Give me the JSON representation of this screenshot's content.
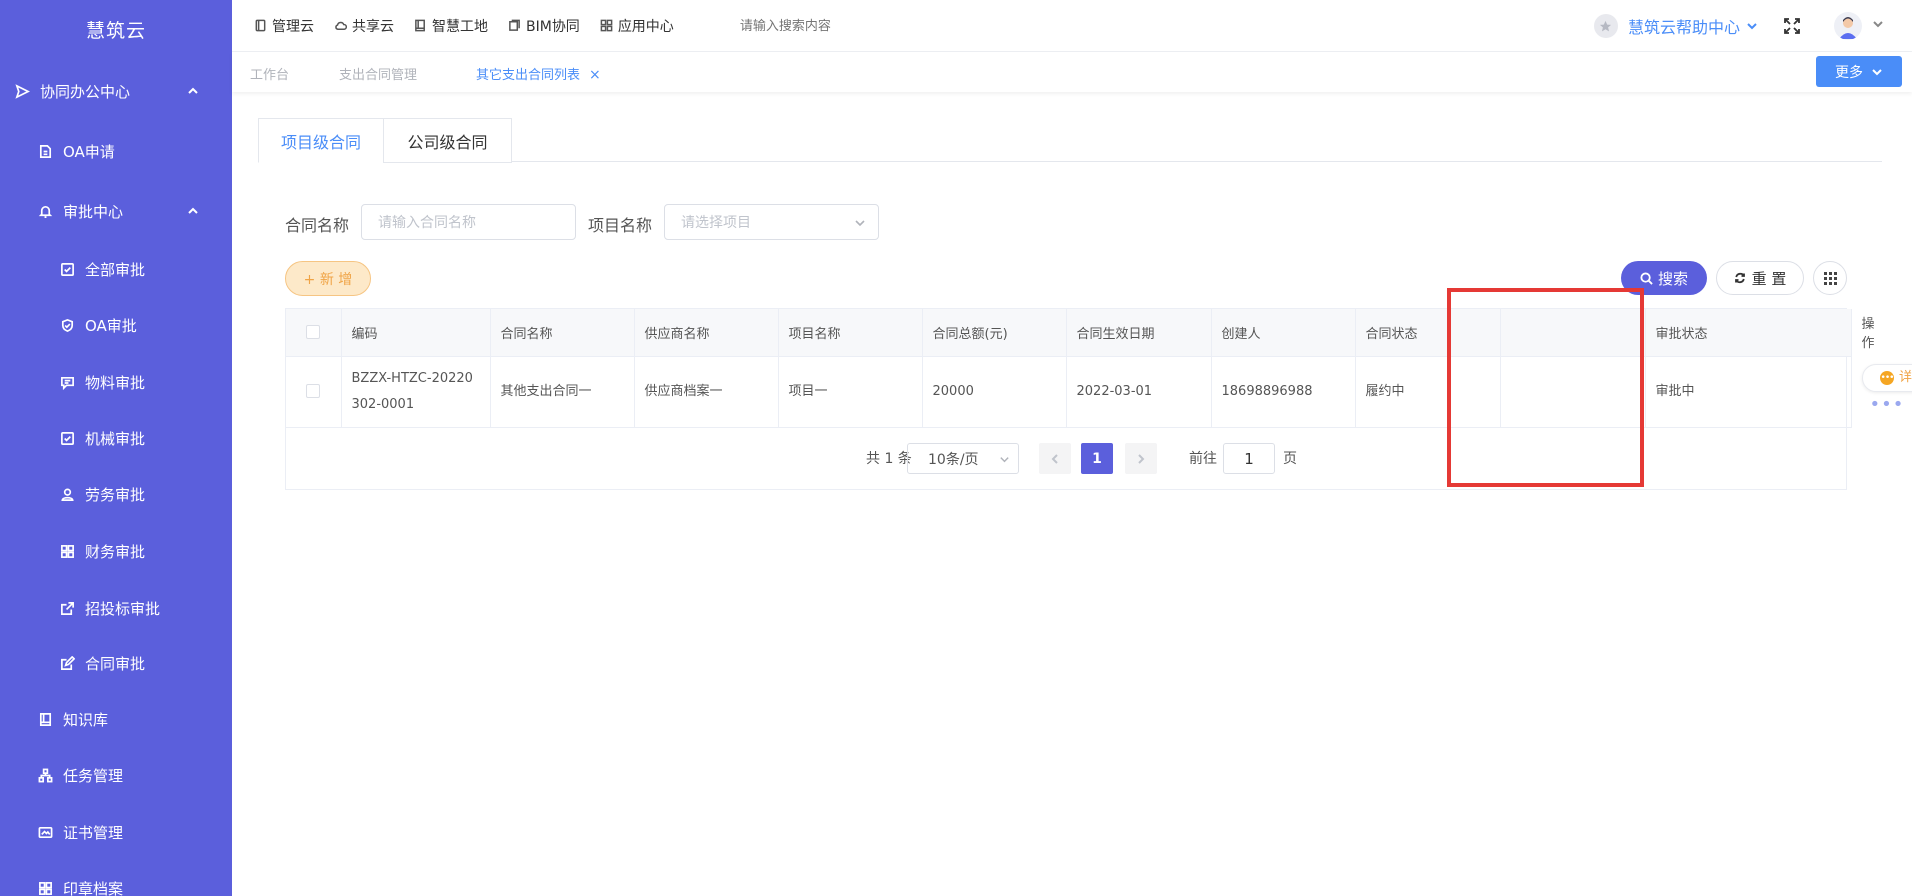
{
  "sidebar": {
    "logo": "慧筑云",
    "items": [
      {
        "label": "协同办公中心",
        "icon": "send-icon"
      },
      {
        "label": "OA申请",
        "icon": "document-icon"
      },
      {
        "label": "审批中心",
        "icon": "bell-icon"
      },
      {
        "label": "全部审批",
        "icon": "checkbox-icon"
      },
      {
        "label": "OA审批",
        "icon": "shield-check-icon"
      },
      {
        "label": "物料审批",
        "icon": "message-icon"
      },
      {
        "label": "机械审批",
        "icon": "checkbox-icon"
      },
      {
        "label": "劳务审批",
        "icon": "user-icon"
      },
      {
        "label": "财务审批",
        "icon": "grid-icon"
      },
      {
        "label": "招投标审批",
        "icon": "external-link-icon"
      },
      {
        "label": "合同审批",
        "icon": "edit-icon"
      },
      {
        "label": "知识库",
        "icon": "book-icon"
      },
      {
        "label": "任务管理",
        "icon": "sitemap-icon"
      },
      {
        "label": "证书管理",
        "icon": "id-card-icon"
      },
      {
        "label": "印章档案",
        "icon": "grid-icon"
      }
    ]
  },
  "topbar": {
    "nav": [
      {
        "label": "管理云",
        "icon": "tablet-icon"
      },
      {
        "label": "共享云",
        "icon": "cloud-icon"
      },
      {
        "label": "智慧工地",
        "icon": "book-icon"
      },
      {
        "label": "BIM协同",
        "icon": "layers-icon"
      },
      {
        "label": "应用中心",
        "icon": "grid-icon"
      }
    ],
    "search_placeholder": "请输入搜索内容",
    "help_label": "慧筑云帮助中心"
  },
  "tabs": {
    "items": [
      {
        "label": "工作台"
      },
      {
        "label": "支出合同管理"
      },
      {
        "label": "其它支出合同列表"
      }
    ],
    "close_glyph": "×",
    "more_label": "更多"
  },
  "content_tabs": [
    "项目级合同",
    "公司级合同"
  ],
  "filters": {
    "contract_name_label": "合同名称",
    "contract_name_placeholder": "请输入合同名称",
    "project_name_label": "项目名称",
    "project_name_placeholder": "请选择项目"
  },
  "buttons": {
    "add": "+ 新 增",
    "search": "搜索",
    "reset": "重 置"
  },
  "table": {
    "headers": [
      "编码",
      "合同名称",
      "供应商名称",
      "项目名称",
      "合同总额(元)",
      "合同生效日期",
      "创建人",
      "合同状态",
      "",
      "审批状态",
      "操作"
    ],
    "rows": [
      {
        "code_line1": "BZZX-HTZC-20220",
        "code_line2": "302-0001",
        "contract_name": "其他支出合同一",
        "supplier": "供应商档案一",
        "project": "项目一",
        "amount": "20000",
        "effective_date": "2022-03-01",
        "creator": "18698896988",
        "contract_status": "履约中",
        "blank": "",
        "approval_status": "审批中",
        "detail_label": "详情",
        "detail_dot": "•••",
        "more_label": "•••"
      }
    ]
  },
  "pagination": {
    "total": "共 1 条",
    "page_size": "10条/页",
    "current_page": "1",
    "goto_label": "前往",
    "goto_value": "1",
    "page_word": "页"
  },
  "annotation": {
    "highlight_color": "#e53935"
  }
}
